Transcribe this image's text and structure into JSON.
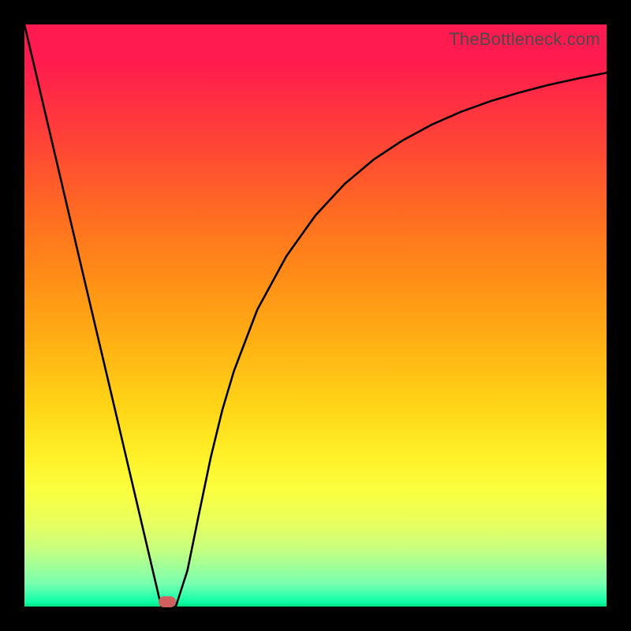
{
  "watermark": "TheBottleneck.com",
  "chart_data": {
    "type": "line",
    "title": "",
    "xlabel": "",
    "ylabel": "",
    "xlim": [
      0,
      1
    ],
    "ylim": [
      0,
      1
    ],
    "series": [
      {
        "name": "curve",
        "x": [
          0.0,
          0.05,
          0.1,
          0.15,
          0.2,
          0.235,
          0.26,
          0.28,
          0.3,
          0.32,
          0.34,
          0.36,
          0.4,
          0.45,
          0.5,
          0.55,
          0.6,
          0.65,
          0.7,
          0.75,
          0.8,
          0.85,
          0.9,
          0.95,
          1.0
        ],
        "values": [
          1.0,
          0.787,
          0.574,
          0.362,
          0.149,
          0.0,
          0.0,
          0.062,
          0.16,
          0.256,
          0.338,
          0.405,
          0.51,
          0.602,
          0.672,
          0.726,
          0.768,
          0.801,
          0.828,
          0.85,
          0.868,
          0.883,
          0.896,
          0.907,
          0.917
        ]
      }
    ],
    "marker": {
      "x": 0.245,
      "y": 0.0
    },
    "background_gradient": {
      "top": "#ff1a4f",
      "bottom": "#00e47e"
    }
  }
}
